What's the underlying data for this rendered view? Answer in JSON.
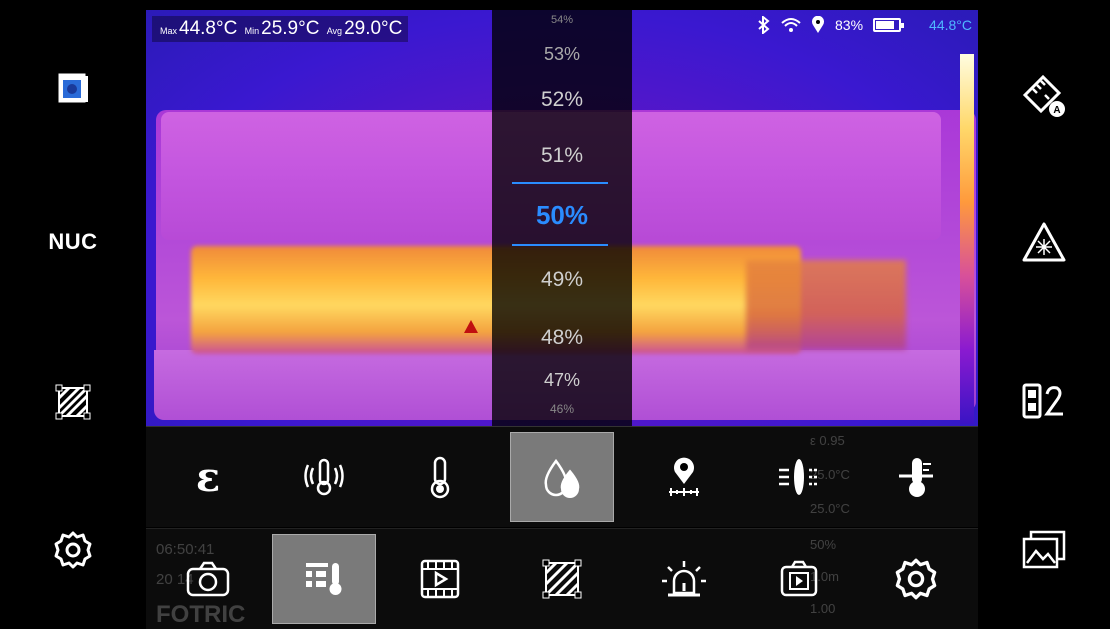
{
  "stats": {
    "max_label": "Max",
    "max_value": "44.8°C",
    "min_label": "Min",
    "min_value": "25.9°C",
    "avg_label": "Avg",
    "avg_value": "29.0°C"
  },
  "status_bar": {
    "battery_percent": "83%",
    "battery_level": 0.83,
    "temp_readout": "44.8°C"
  },
  "left_sidebar": {
    "items": [
      {
        "icon": "layers-icon"
      },
      {
        "label": "NUC"
      },
      {
        "icon": "area-selection-icon"
      },
      {
        "icon": "settings-gear-icon"
      }
    ]
  },
  "right_sidebar": {
    "items": [
      {
        "icon": "auto-measure-ruler-icon"
      },
      {
        "icon": "laser-warning-icon"
      },
      {
        "icon": "mode-switch-icon"
      },
      {
        "icon": "gallery-icon"
      }
    ]
  },
  "humidity_picker": {
    "options": [
      "54%",
      "53%",
      "52%",
      "51%",
      "50%",
      "49%",
      "48%",
      "47%",
      "46%"
    ],
    "selected": "50%"
  },
  "parameter_toolbar": {
    "items": [
      {
        "icon": "emissivity-icon",
        "label": "ε"
      },
      {
        "icon": "reflected-temp-icon"
      },
      {
        "icon": "ambient-temp-icon"
      },
      {
        "icon": "humidity-icon",
        "active": true
      },
      {
        "icon": "distance-icon"
      },
      {
        "icon": "lens-transmission-icon"
      },
      {
        "icon": "temperature-compensation-icon"
      }
    ]
  },
  "main_toolbar": {
    "items": [
      {
        "icon": "camera-icon"
      },
      {
        "icon": "parameters-icon",
        "active": true
      },
      {
        "icon": "video-icon"
      },
      {
        "icon": "area-selection-icon"
      },
      {
        "icon": "alarm-icon"
      },
      {
        "icon": "playback-icon"
      },
      {
        "icon": "settings-icon"
      }
    ]
  },
  "ghost_overlay": {
    "time": "06:50:41",
    "date": "20 14",
    "brand": "FOTRIC",
    "params": [
      "ε 0.95",
      "25.0°C",
      "25.0°C",
      "50%",
      "1.0m",
      "1.00"
    ]
  }
}
